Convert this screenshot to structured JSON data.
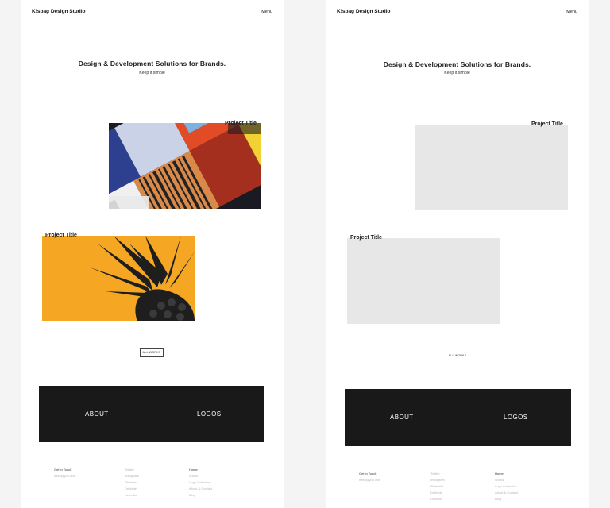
{
  "brand": "K!sbag Design Studio",
  "menu_label": "Menu",
  "hero": {
    "title": "Design & Development Solutions for Brands.",
    "subtitle": "Keep it simple"
  },
  "projects": [
    {
      "title": "Project Title"
    },
    {
      "title": "Project Title"
    }
  ],
  "all_works_label": "ALL WORKS",
  "blocks": {
    "about_label": "ABOUT",
    "logos_label": "LOGOS"
  },
  "footer": {
    "contact": [
      "Get in Touch",
      "hello@you.one"
    ],
    "social": [
      "Twitter",
      "Instagram",
      "Pinterest",
      "Dribbble",
      "LinkedIn"
    ],
    "nav": [
      "Home",
      "Works",
      "Logo Collection",
      "About & Contact",
      "Blog"
    ]
  },
  "colors": {
    "page_bg": "#f4f4f4",
    "card_bg": "#ffffff",
    "dark_block": "#191919",
    "placeholder": "#e7e7e7",
    "orange": "#f5a623"
  }
}
